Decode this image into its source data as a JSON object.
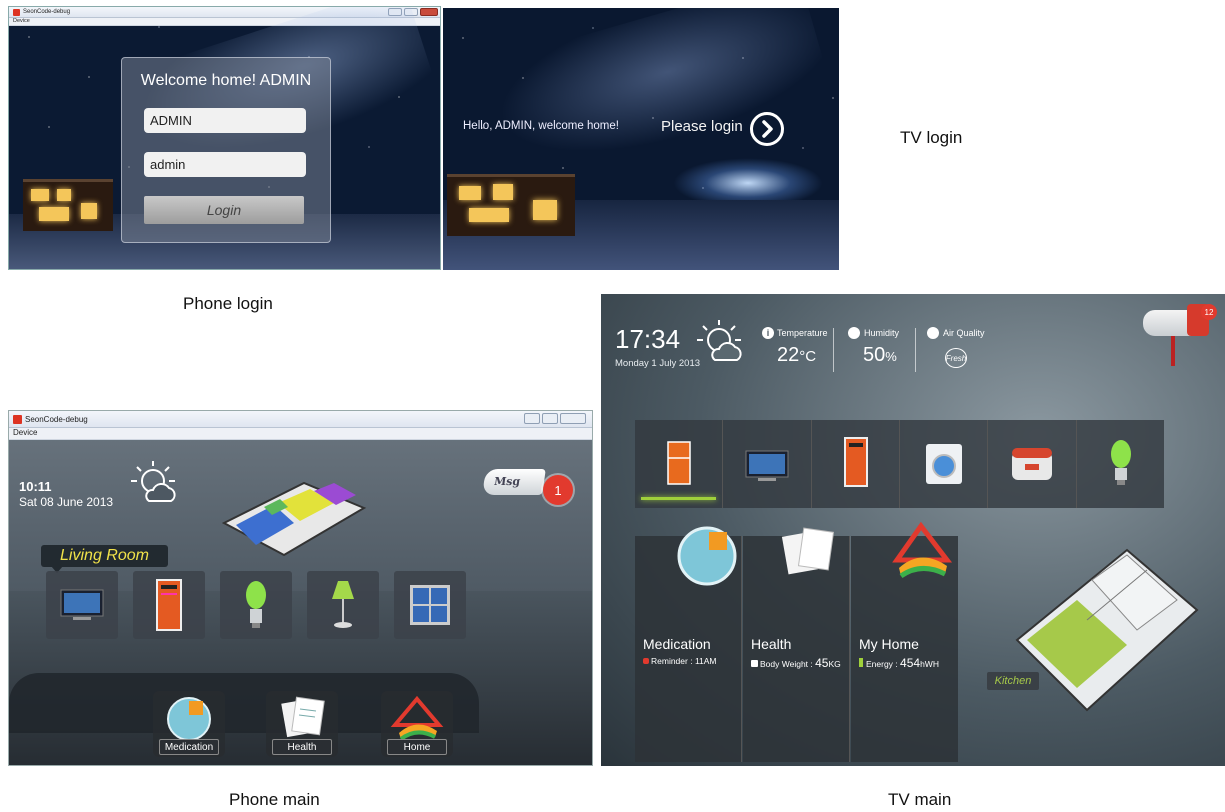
{
  "captions": {
    "tv_login": "TV login",
    "phone_login": "Phone login",
    "phone_main": "Phone main",
    "tv_main": "TV main"
  },
  "phone_login": {
    "window_title": "SeonCode-debug",
    "menu": "Device",
    "welcome": "Welcome home! ADMIN",
    "username_value": "ADMIN",
    "password_value": "admin",
    "login_button": "Login"
  },
  "tv_login": {
    "greeting": "Hello, ADMIN, welcome home!",
    "please_login": "Please login"
  },
  "phone_main": {
    "window_title": "SeonCode-debug",
    "menu": "Device",
    "time": "10:11",
    "date": "Sat 08 June 2013",
    "room_label": "Living Room",
    "msg_label": "Msg",
    "msg_count": "1",
    "bottom_buttons": [
      "Medication",
      "Health",
      "Home"
    ]
  },
  "tv_main": {
    "time": "17:34",
    "date": "Monday 1 July 2013",
    "temperature_label": "Temperature",
    "temperature_value": "22",
    "temperature_unit": "°C",
    "humidity_label": "Humidity",
    "humidity_value": "50",
    "humidity_unit": "%",
    "air_quality_label": "Air Quality",
    "air_quality_value": "Fresh",
    "mailbox_count": "12",
    "cards": [
      {
        "title": "Medication",
        "detail_label": "Reminder : ",
        "detail_value": "11AM"
      },
      {
        "title": "Health",
        "detail_label": "Body Weight : ",
        "detail_value": "45",
        "detail_unit": "KG"
      },
      {
        "title": "My Home",
        "detail_label": "Energy : ",
        "detail_value": "454",
        "detail_unit": "hWH"
      }
    ],
    "room_label": "Kitchen"
  },
  "colors": {
    "accent_green": "#9fd03b",
    "badge_red": "#e23a2e",
    "room_label_yellow": "#f1e24a"
  }
}
